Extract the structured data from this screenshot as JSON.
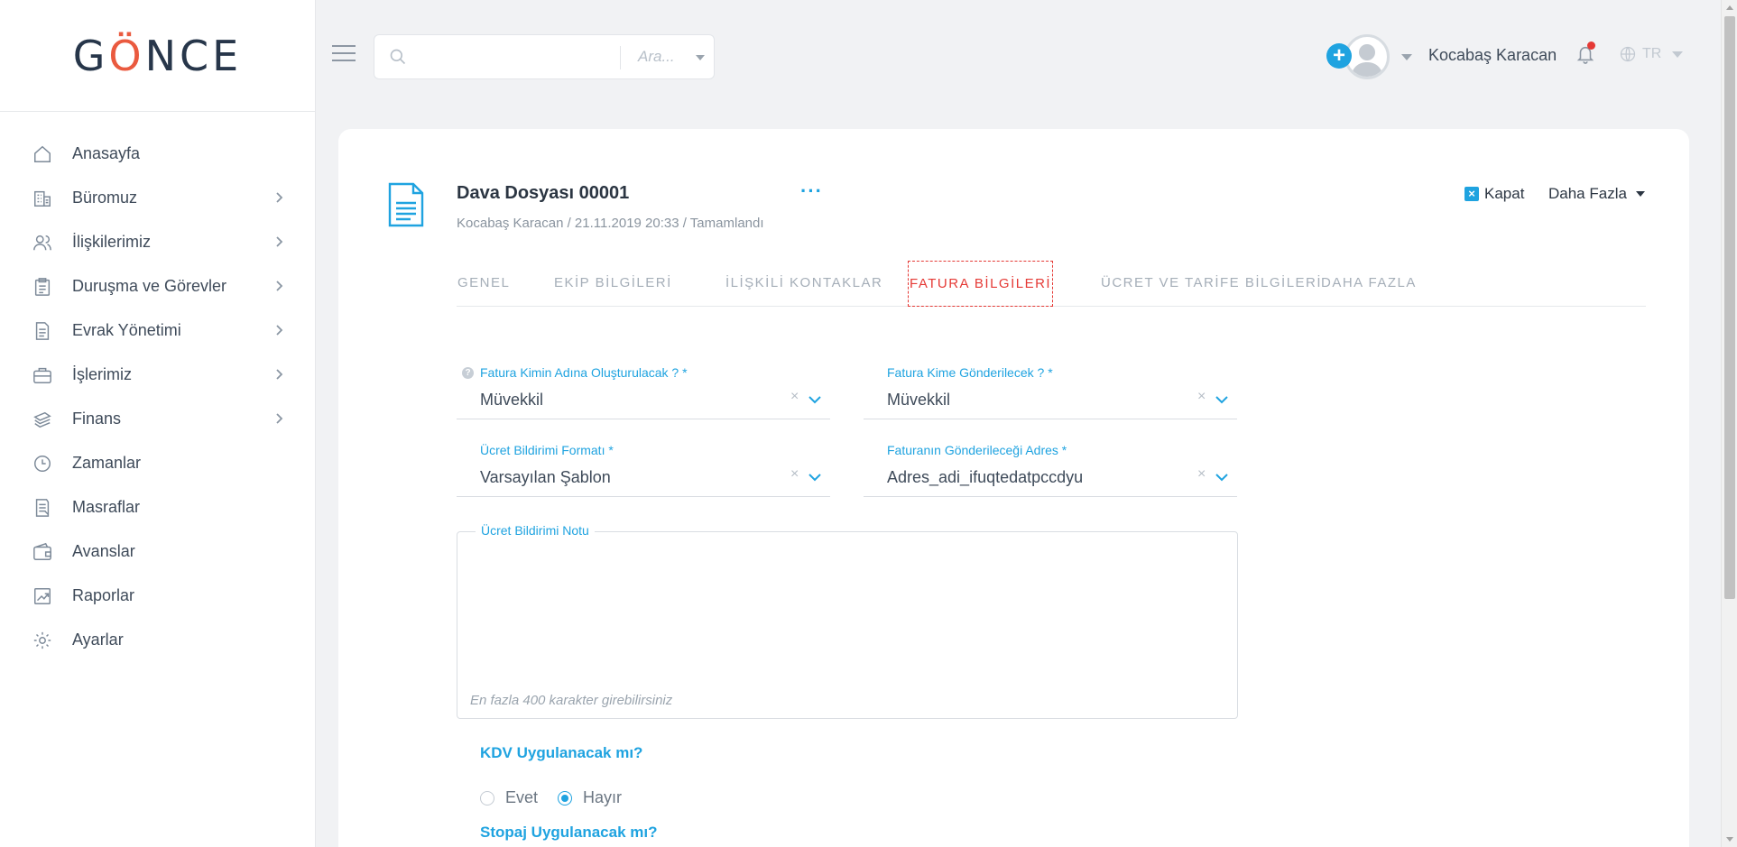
{
  "brand": {
    "logo_prefix": "G",
    "logo_o": "Ö",
    "logo_suffix": "NCE"
  },
  "sidebar": {
    "items": [
      {
        "label": "Anasayfa",
        "icon": "home-icon",
        "has_submenu": false
      },
      {
        "label": "Büromuz",
        "icon": "building-icon",
        "has_submenu": true
      },
      {
        "label": "İlişkilerimiz",
        "icon": "users-icon",
        "has_submenu": true
      },
      {
        "label": "Duruşma ve Görevler",
        "icon": "clipboard-icon",
        "has_submenu": true
      },
      {
        "label": "Evrak Yönetimi",
        "icon": "document-icon",
        "has_submenu": true
      },
      {
        "label": "İşlerimiz",
        "icon": "briefcase-icon",
        "has_submenu": true
      },
      {
        "label": "Finans",
        "icon": "money-icon",
        "has_submenu": true
      },
      {
        "label": "Zamanlar",
        "icon": "clock-icon",
        "has_submenu": false
      },
      {
        "label": "Masraflar",
        "icon": "receipt-icon",
        "has_submenu": false
      },
      {
        "label": "Avanslar",
        "icon": "wallet-icon",
        "has_submenu": false
      },
      {
        "label": "Raporlar",
        "icon": "chart-icon",
        "has_submenu": false
      },
      {
        "label": "Ayarlar",
        "icon": "gear-icon",
        "has_submenu": false
      }
    ]
  },
  "header": {
    "search_value": "",
    "search_scope": "Ara...",
    "user_name": "Kocabaş Karacan",
    "language": "TR",
    "add_label": "+"
  },
  "case": {
    "title": "Dava Dosyası 00001",
    "meta": "Kocabaş Karacan / 21.11.2019 20:33 / Tamamlandı",
    "more_dots": "···",
    "close_label": "Kapat",
    "close_icon_glyph": "×",
    "more_label": "Daha Fazla"
  },
  "tabs": [
    {
      "label": "GENEL",
      "active": false
    },
    {
      "label": "EKİP BİLGİLERİ",
      "active": false
    },
    {
      "label": "İLİŞKİLİ KONTAKLAR",
      "active": false
    },
    {
      "label": "FATURA BİLGİLERİ",
      "active": true
    },
    {
      "label": "ÜCRET VE TARİFE BİLGİLERİ",
      "active": false
    },
    {
      "label": "DAHA FAZLA",
      "active": false
    }
  ],
  "form": {
    "invoice_for": {
      "label": "Fatura Kimin Adına Oluşturulacak ? *",
      "value": "Müvekkil",
      "help": "?"
    },
    "invoice_to": {
      "label": "Fatura Kime Gönderilecek ? *",
      "value": "Müvekkil"
    },
    "fee_format": {
      "label": "Ücret Bildirimi Formatı *",
      "value": "Varsayılan Şablon"
    },
    "invoice_address": {
      "label": "Faturanın Gönderileceği Adres *",
      "value": "Adres_adi_ifuqtedatpccdyu"
    },
    "clear_glyph": "×",
    "fee_note": {
      "label": "Ücret Bildirimi Notu",
      "value": "",
      "hint": "En fazla 400 karakter girebilirsiniz"
    },
    "vat_question": "KDV Uygulanacak mı?",
    "vat_options": [
      {
        "label": "Evet",
        "checked": false
      },
      {
        "label": "Hayır",
        "checked": true
      }
    ],
    "withholding_question": "Stopaj Uygulanacak mı?"
  },
  "colors": {
    "accent": "#1fa3e0",
    "active_tab": "#e53935",
    "logo_dark": "#27364a",
    "logo_accent": "#ea5a3f",
    "notification_dot": "#e53935"
  }
}
